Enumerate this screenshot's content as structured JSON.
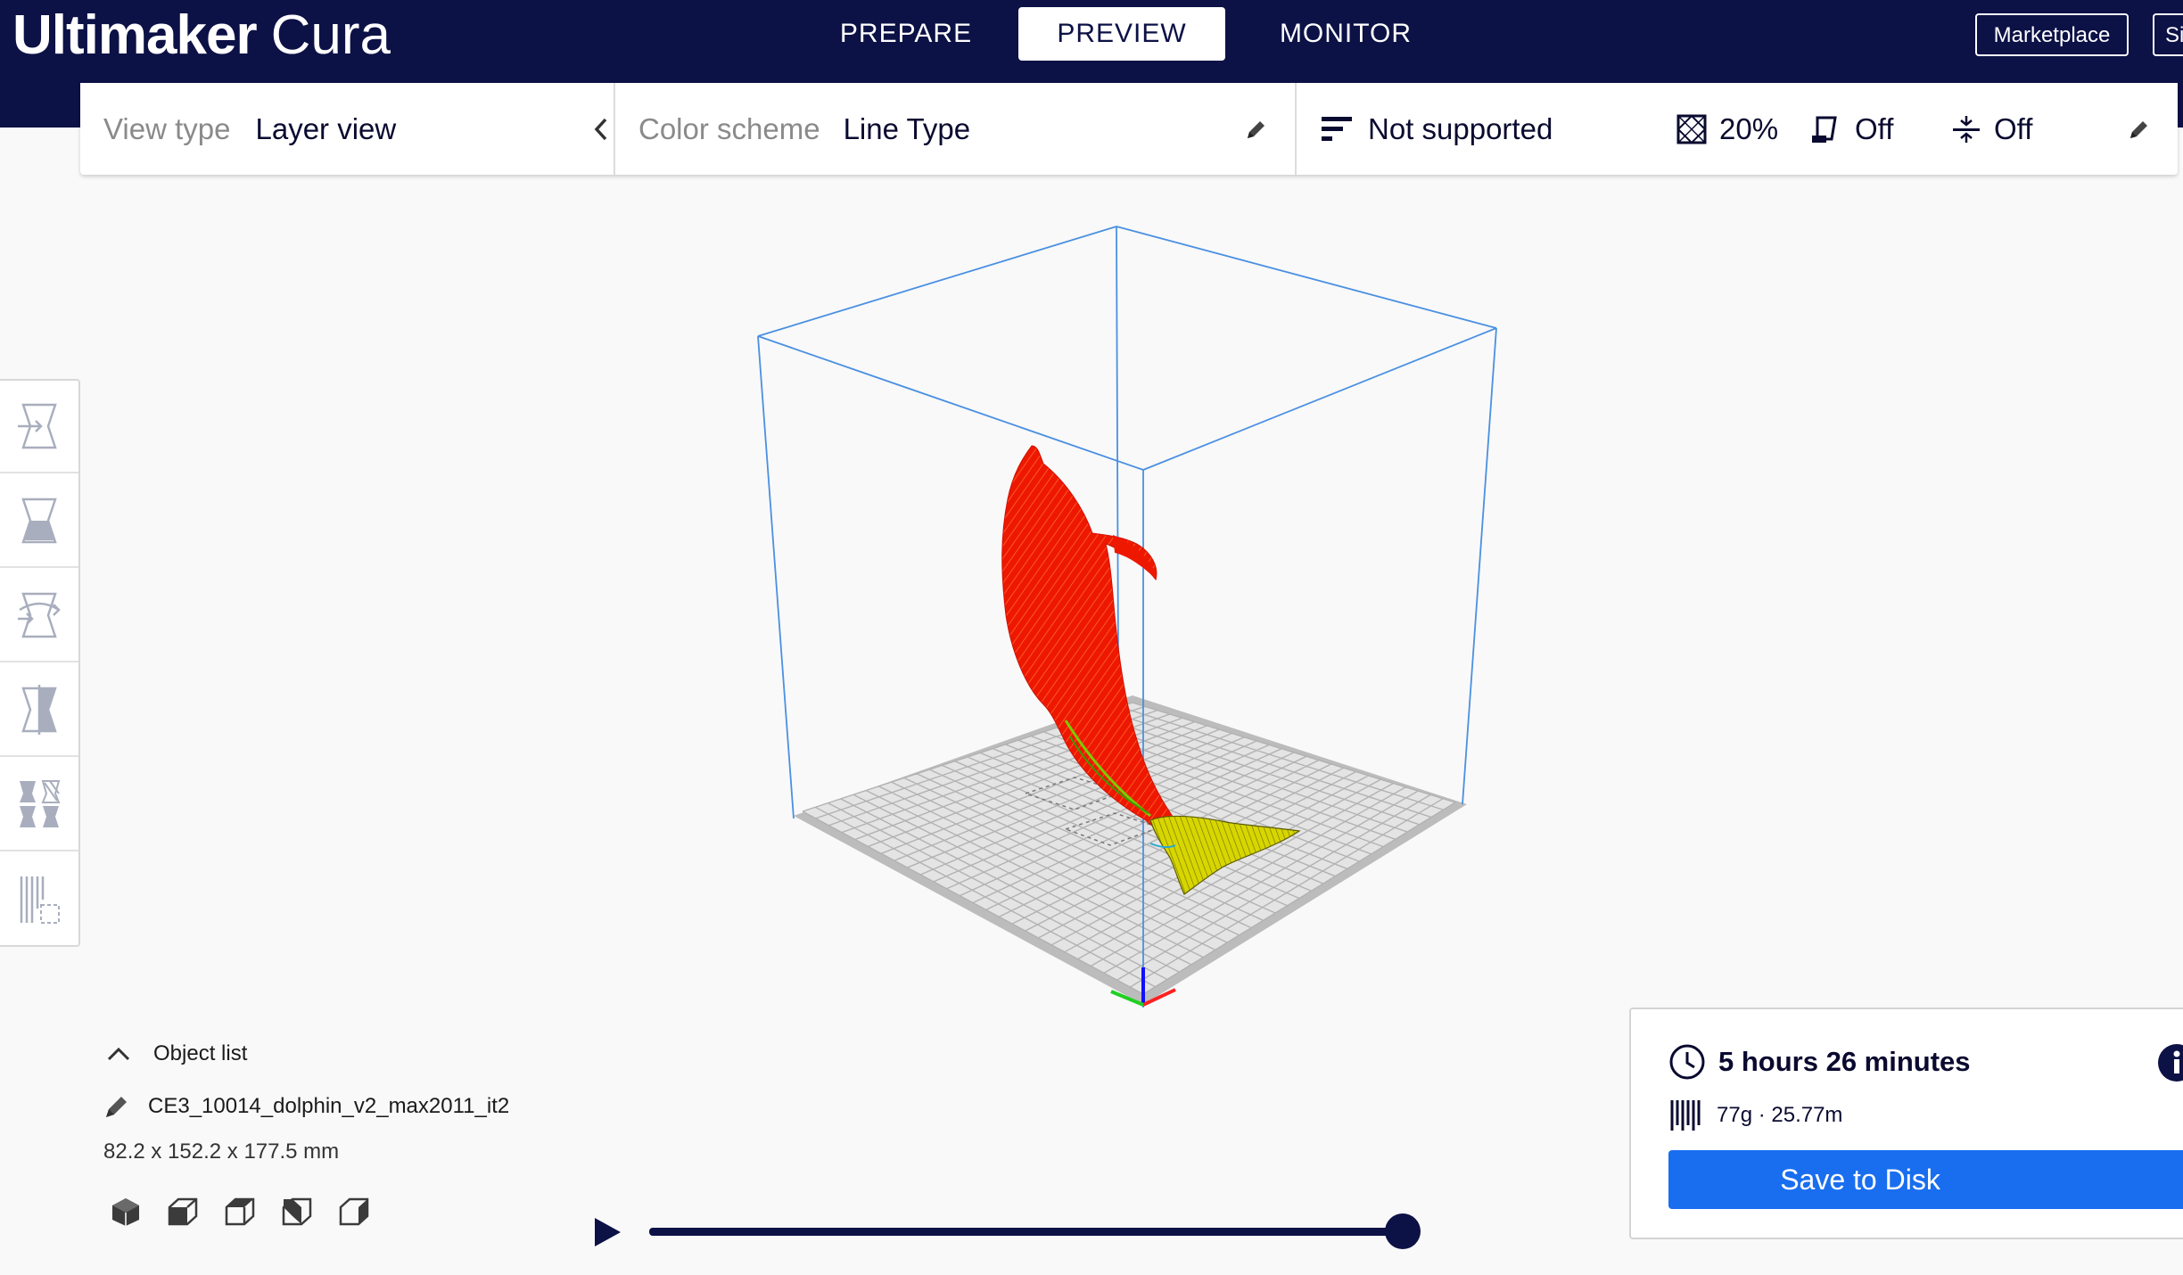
{
  "app": {
    "name_bold": "Ultimaker",
    "name_light": "Cura"
  },
  "nav": {
    "tabs": [
      {
        "label": "PREPARE"
      },
      {
        "label": "PREVIEW"
      },
      {
        "label": "MONITOR"
      }
    ],
    "active_tab": "PREVIEW"
  },
  "header": {
    "marketplace_label": "Marketplace",
    "signin_label": "Si"
  },
  "view_type": {
    "label": "View type",
    "value": "Layer view"
  },
  "color_scheme": {
    "label": "Color scheme",
    "value": "Line Type"
  },
  "print_settings": {
    "support": "Not supported",
    "infill": "20%",
    "adhesion": "Off",
    "ironing": "Off"
  },
  "object_list": {
    "toggle_label": "Object list",
    "object_name": "CE3_10014_dolphin_v2_max2011_it2",
    "dimensions": "82.2 x 152.2 x 177.5 mm"
  },
  "print_info": {
    "time": "5 hours 26 minutes",
    "material": "77g · 25.77m",
    "save_label": "Save to Disk"
  },
  "layer_slider": {
    "progress": 1.0
  },
  "colors": {
    "header_bg": "#0c1146",
    "accent_blue": "#196ef0",
    "build_volume_lines": "#4a90e2",
    "model_red": "#ff1a00",
    "model_yellow": "#d7d700",
    "axis_x": "#ff2020",
    "axis_y": "#1010ff",
    "axis_z": "#20d020"
  }
}
